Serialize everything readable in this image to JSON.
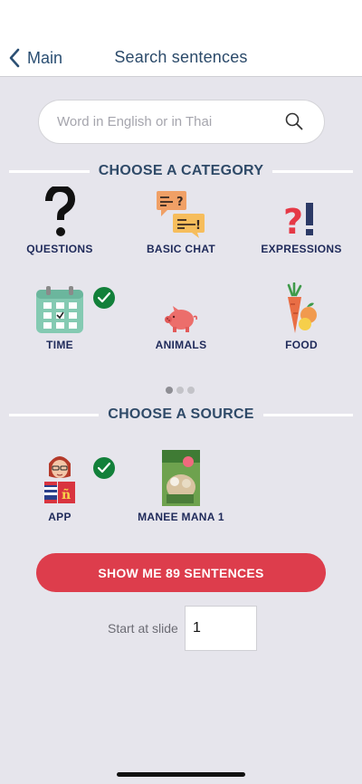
{
  "nav": {
    "back_label": "Main",
    "title": "Search sentences"
  },
  "search": {
    "placeholder": "Word in English or in Thai",
    "value": ""
  },
  "category_section": {
    "title": "CHOOSE A CATEGORY"
  },
  "categories": [
    {
      "label": "QUESTIONS",
      "icon": "question-mark-icon",
      "selected": false
    },
    {
      "label": "BASIC CHAT",
      "icon": "chat-bubbles-icon",
      "selected": false
    },
    {
      "label": "EXPRESSIONS",
      "icon": "exclamation-icon",
      "selected": false
    },
    {
      "label": "TIME",
      "icon": "calendar-icon",
      "selected": true
    },
    {
      "label": "ANIMALS",
      "icon": "pig-icon",
      "selected": false
    },
    {
      "label": "FOOD",
      "icon": "carrot-icon",
      "selected": false
    }
  ],
  "pager": {
    "pages": 3,
    "current": 1
  },
  "source_section": {
    "title": "CHOOSE A SOURCE"
  },
  "sources": [
    {
      "label": "APP",
      "icon": "app-character-icon",
      "selected": true
    },
    {
      "label": "MANEE MANA 1",
      "icon": "book-cover-icon",
      "selected": false
    }
  ],
  "cta": {
    "label": "SHOW ME 89 SENTENCES"
  },
  "start": {
    "label": "Start at slide",
    "value": "1"
  },
  "colors": {
    "accent": "#dd3d4c",
    "check": "#12803a",
    "heading": "#2f4a68",
    "label": "#1f2a5a"
  }
}
